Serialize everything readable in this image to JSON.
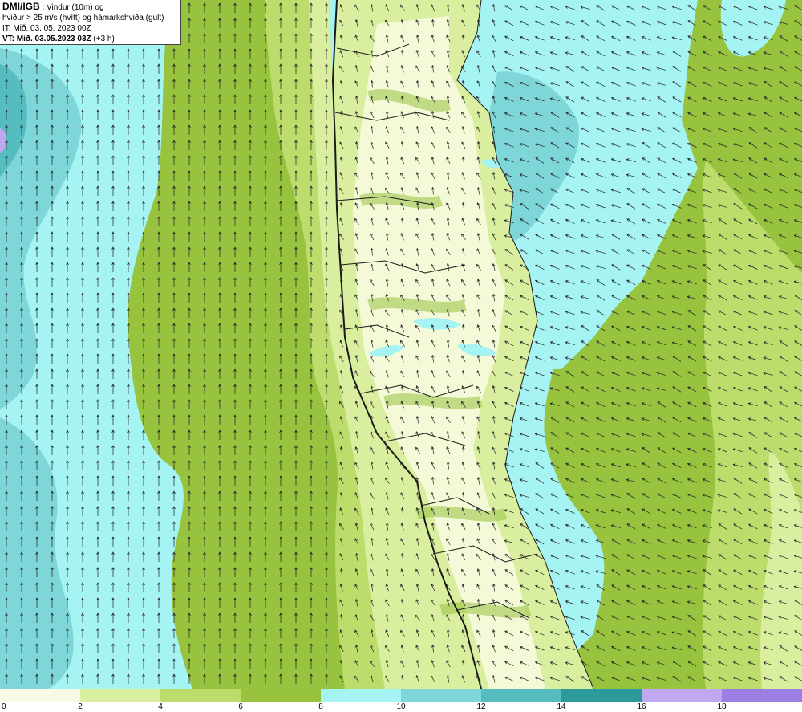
{
  "header": {
    "brand": "DMI/IGB",
    "title_rest": " : Vindur (10m) og",
    "line2": "hviður > 25 m/s (hvítt) og hámarkshviða (gult)",
    "issue_time": "IT: Mið. 03. 05. 2023 00Z",
    "valid_prefix": "VT: Mið. 03.05.2023 03Z",
    "valid_suffix": " (+3 h)"
  },
  "legend": {
    "ticks": [
      "0",
      "2",
      "4",
      "6",
      "8",
      "10",
      "12",
      "14",
      "16",
      "18"
    ],
    "colors": [
      "#f7fbe6",
      "#d9ee9f",
      "#bcdc6c",
      "#97c33f",
      "#a5f3f3",
      "#7fd6d8",
      "#55bcbf",
      "#2c9a9a",
      "#bfa8ef",
      "#9c7fe2"
    ]
  },
  "map_colors": {
    "light_cream": "#f4f9d8",
    "pale_green": "#d9ee9f",
    "light_green": "#bcdc6c",
    "mid_green": "#97c33f",
    "cyan": "#a5f3f3",
    "teal_light": "#7fd6d8",
    "teal": "#55bcbf",
    "dark_teal": "#2c9a9a",
    "lilac": "#bfa8ef",
    "coastline": "#1a1a1a",
    "arrow": "#222222"
  }
}
